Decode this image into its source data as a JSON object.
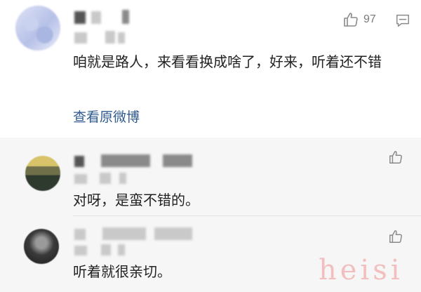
{
  "main_comment": {
    "text": "咱就是路人，来看看换成啥了，好来，听着还不错",
    "like_count": "97",
    "view_original_label": "查看原微博"
  },
  "replies": [
    {
      "text": "对呀，是蛮不错的。"
    },
    {
      "text": "听着就很亲切。"
    }
  ],
  "watermark": "heisi",
  "colors": {
    "link": "#2f5a8f",
    "reply_bg": "#f6f6f6",
    "icon": "#8a8a8a"
  }
}
